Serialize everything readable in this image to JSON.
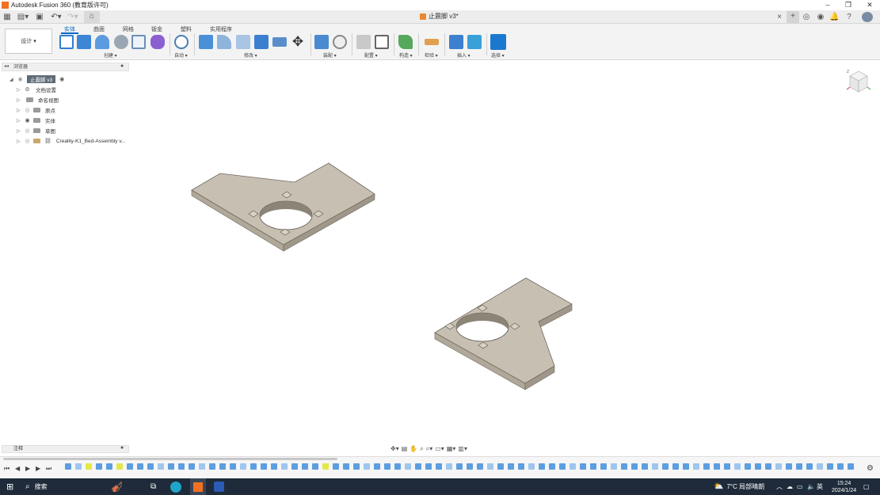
{
  "window": {
    "title": "Autodesk Fusion 360 (教育版许可)",
    "minimize": "–",
    "maximize": "❐",
    "close": "✕"
  },
  "document_tab": {
    "name": "止震脚 v3*",
    "close": "×"
  },
  "ribbon": {
    "tabs": [
      "实体",
      "曲面",
      "网格",
      "钣金",
      "塑料",
      "实用程序"
    ],
    "active_tab": "实体",
    "workspace_button": "设计 ▾",
    "groups": [
      "创建 ▾",
      "自动 ▾",
      "修改 ▾",
      "装配 ▾",
      "配置 ▾",
      "构造 ▾",
      "检验 ▾",
      "插入 ▾",
      "选择 ▾"
    ]
  },
  "browser": {
    "header": "浏览器",
    "root": "止震脚 v3",
    "items": [
      {
        "label": "文档设置",
        "icon": "gear-icon"
      },
      {
        "label": "命名视图",
        "icon": "folder-icon"
      },
      {
        "label": "原点",
        "icon": "folder-icon"
      },
      {
        "label": "实体",
        "icon": "folder-icon"
      },
      {
        "label": "草图",
        "icon": "folder-icon"
      },
      {
        "label": "Creality-K1_Bed-Assembly v...",
        "icon": "link-icon"
      }
    ]
  },
  "notes_panel": {
    "label": "注释"
  },
  "taskbar": {
    "search": "搜索",
    "weather": "7°C  局部晴朗",
    "ime": "英",
    "time": "15:24",
    "date": "2024/1/24"
  },
  "colors": {
    "accent": "#0a67c5",
    "part_fill": "#bdb6a8",
    "part_top": "#c8c1b3",
    "part_edge": "#8c857a",
    "taskbar": "#1f2b3a"
  }
}
